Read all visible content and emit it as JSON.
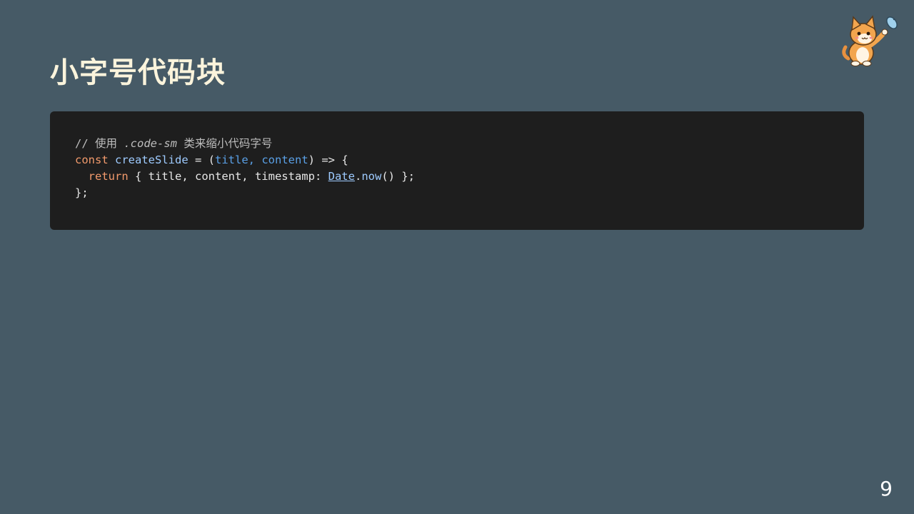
{
  "slide": {
    "title": "小字号代码块",
    "page_number": "9"
  },
  "code": {
    "lines": [
      [
        {
          "type": "comment",
          "text": "// 使用 "
        },
        {
          "type": "comment-em",
          "text": ".code-sm"
        },
        {
          "type": "comment",
          "text": " 类来缩小代码字号"
        }
      ],
      [
        {
          "type": "keyword",
          "text": "const"
        },
        {
          "type": "plain",
          "text": " "
        },
        {
          "type": "fn",
          "text": "createSlide"
        },
        {
          "type": "plain",
          "text": " = ("
        },
        {
          "type": "param",
          "text": "title, content"
        },
        {
          "type": "plain",
          "text": ") => {"
        }
      ],
      [
        {
          "type": "plain",
          "text": "  "
        },
        {
          "type": "keyword",
          "text": "return"
        },
        {
          "type": "plain",
          "text": " { title, content, timestamp: "
        },
        {
          "type": "class",
          "text": "Date"
        },
        {
          "type": "plain",
          "text": "."
        },
        {
          "type": "method",
          "text": "now"
        },
        {
          "type": "plain",
          "text": "() };"
        }
      ],
      [
        {
          "type": "plain",
          "text": "};"
        }
      ]
    ]
  },
  "icons": {
    "mascot": "cat-holding-fish-icon"
  },
  "colors": {
    "background": "#465a66",
    "title": "#fbf4dc",
    "code_background": "#1e1e1e",
    "keyword": "#f29a6c",
    "function": "#9ecbff",
    "parameter": "#5aa0e6",
    "comment": "#bdbdbd"
  }
}
